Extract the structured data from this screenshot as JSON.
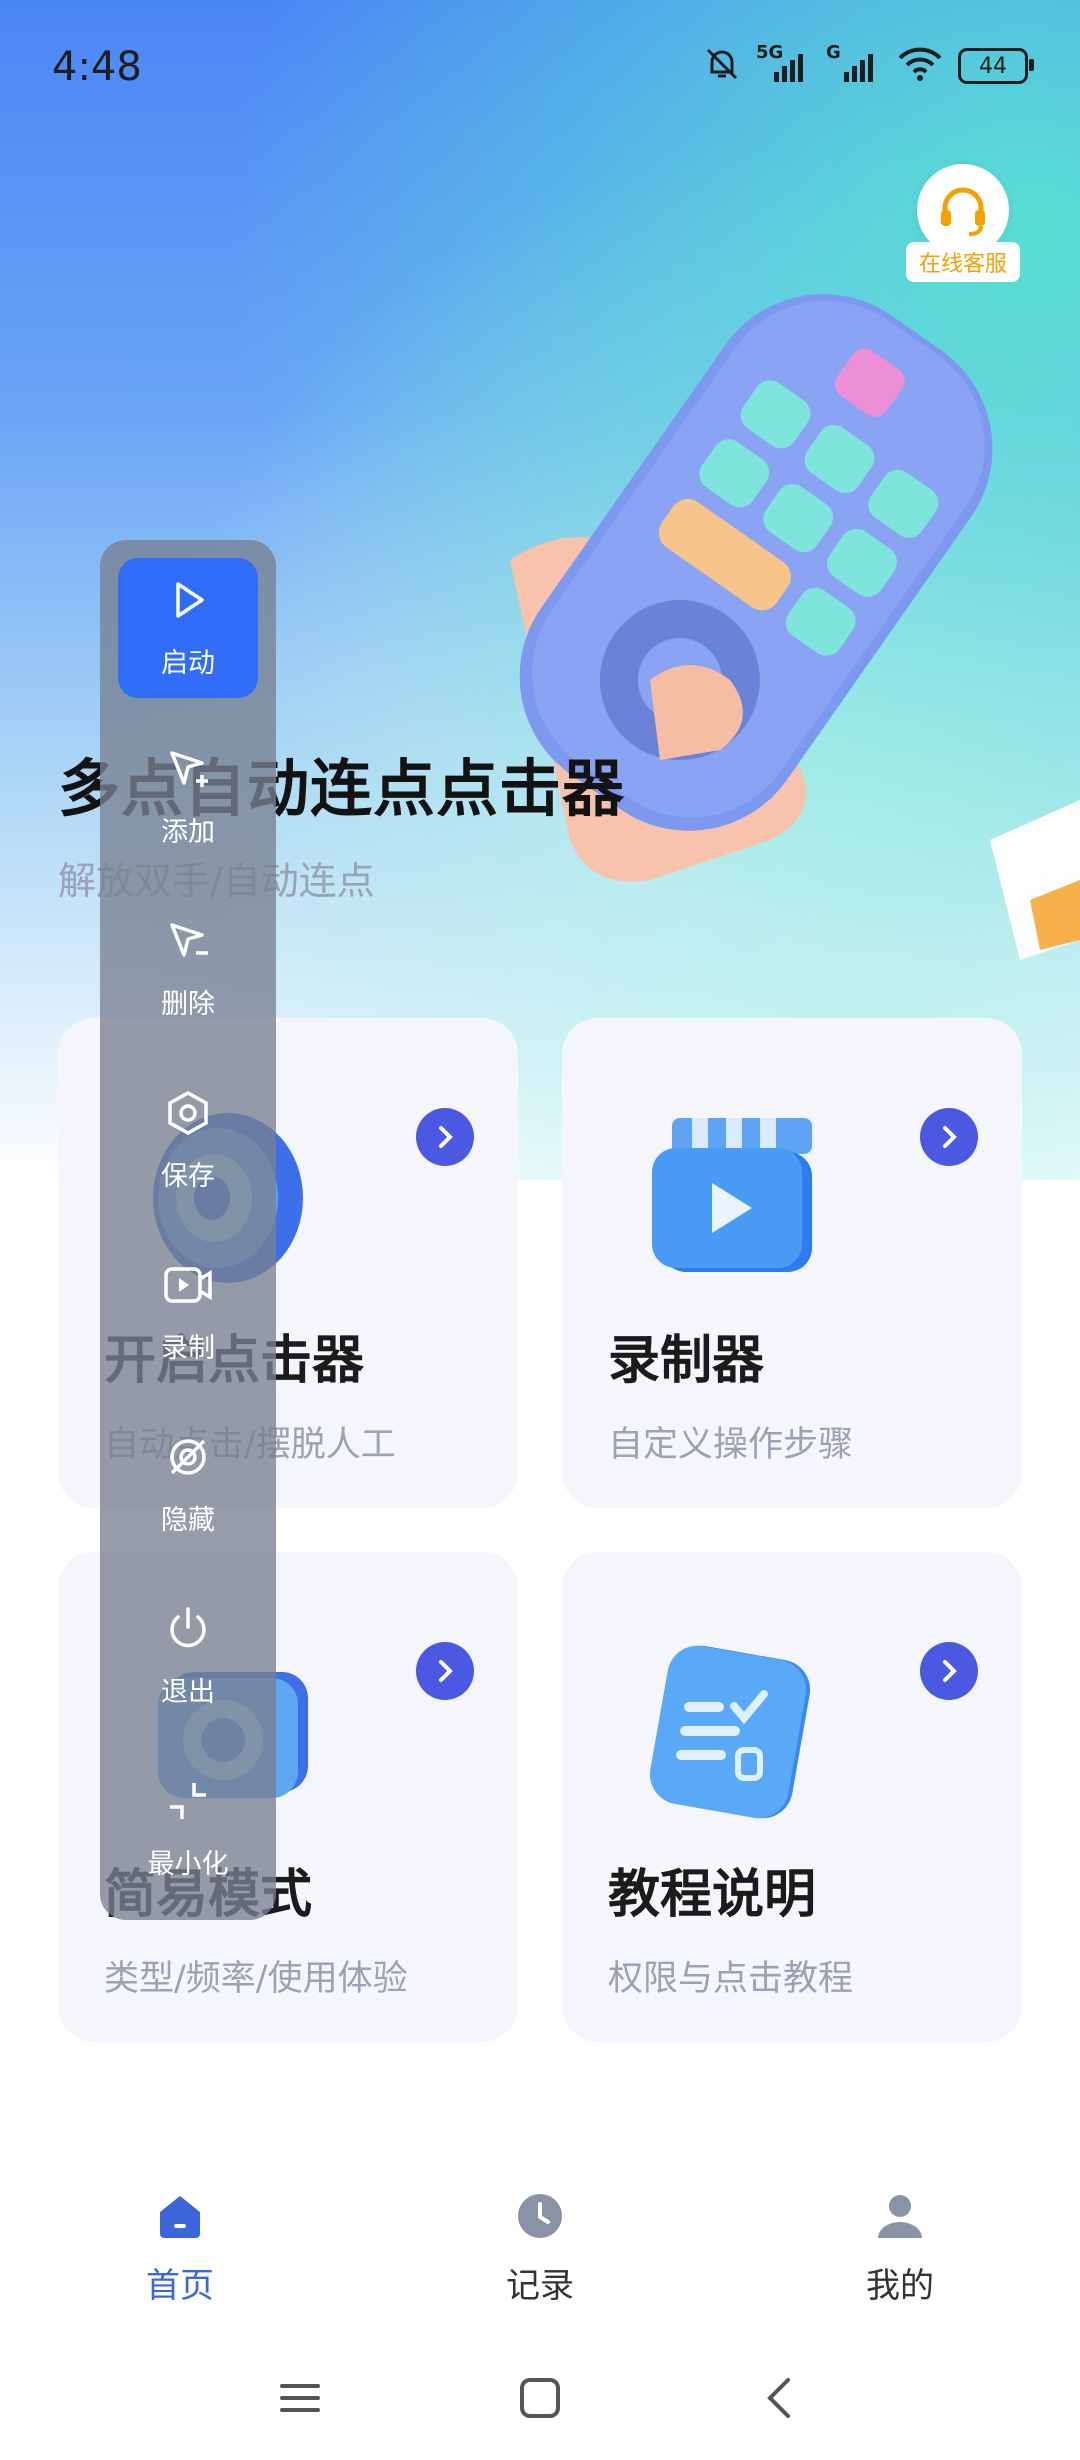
{
  "status_bar": {
    "time": "4:48",
    "signal1_label": "5G",
    "signal2_label": "G",
    "battery": "44"
  },
  "support": {
    "label": "在线客服",
    "icon": "headset-icon"
  },
  "hero": {
    "title": "多点自动连点点击器",
    "subtitle": "解放双手/自动连点"
  },
  "cards": [
    {
      "title": "开启点击器",
      "subtitle": "自动点击/摆脱人工"
    },
    {
      "title": "录制器",
      "subtitle": "自定义操作步骤"
    },
    {
      "title": "简易模式",
      "subtitle": "类型/频率/使用体验"
    },
    {
      "title": "教程说明",
      "subtitle": "权限与点击教程"
    }
  ],
  "float_panel": {
    "items": [
      {
        "label": "启动",
        "icon": "play-icon"
      },
      {
        "label": "添加",
        "icon": "add-pointer-icon"
      },
      {
        "label": "删除",
        "icon": "remove-pointer-icon"
      },
      {
        "label": "保存",
        "icon": "hexagon-save-icon"
      },
      {
        "label": "录制",
        "icon": "video-record-icon"
      },
      {
        "label": "隐藏",
        "icon": "eye-off-icon"
      },
      {
        "label": "退出",
        "icon": "power-icon"
      },
      {
        "label": "最小化",
        "icon": "minimize-icon"
      }
    ]
  },
  "bottom_nav": {
    "items": [
      {
        "label": "首页",
        "icon": "home-icon",
        "active": true
      },
      {
        "label": "记录",
        "icon": "clock-icon",
        "active": false
      },
      {
        "label": "我的",
        "icon": "user-icon",
        "active": false
      }
    ]
  },
  "colors": {
    "accent": "#3b66dc",
    "arrow_button": "#4b58e2",
    "panel_start": "#2f6df6",
    "support_text": "#f5a100"
  }
}
